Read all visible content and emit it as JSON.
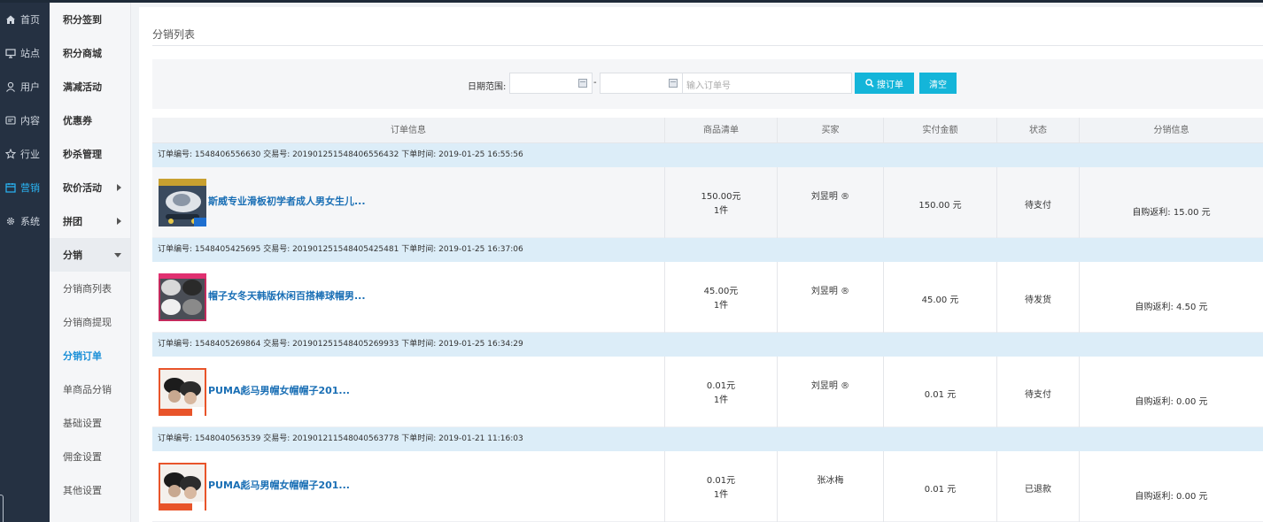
{
  "nav_main": [
    {
      "label": "首页",
      "icon": "home-icon"
    },
    {
      "label": "站点",
      "icon": "monitor-icon"
    },
    {
      "label": "用户",
      "icon": "user-icon"
    },
    {
      "label": "内容",
      "icon": "message-icon"
    },
    {
      "label": "行业",
      "icon": "star-icon"
    },
    {
      "label": "营销",
      "icon": "calendar-icon",
      "active": true
    },
    {
      "label": "系统",
      "icon": "gear-icon"
    }
  ],
  "nav_sub": [
    {
      "label": "积分签到"
    },
    {
      "label": "积分商城"
    },
    {
      "label": "满减活动"
    },
    {
      "label": "优惠券"
    },
    {
      "label": "秒杀管理"
    },
    {
      "label": "砍价活动"
    },
    {
      "label": "拼团"
    },
    {
      "label": "分销"
    },
    {
      "label": "分销商列表"
    },
    {
      "label": "分销商提现"
    },
    {
      "label": "分销订单"
    },
    {
      "label": "单商品分销"
    },
    {
      "label": "基础设置"
    },
    {
      "label": "佣金设置"
    },
    {
      "label": "其他设置"
    }
  ],
  "page": {
    "title": "分销列表"
  },
  "filter": {
    "date_label": "日期范围:",
    "date_start": "",
    "date_end": "",
    "dash": "-",
    "order_placeholder": "输入订单号",
    "search_label": "搜订单",
    "clear_label": "清空"
  },
  "table": {
    "headers": [
      "订单信息",
      "商品清单",
      "买家",
      "实付金额",
      "状态",
      "分销信息"
    ],
    "orders": [
      {
        "info": "订单编号: 1548406556630 交易号: 20190125154840655643​2 下单时间: 2019-01-25 16:55:56",
        "product": "斯威专业滑板初学者成人男女生儿...",
        "thumb_icon": "skateboard-thumbnail",
        "price": "150.00元",
        "qty": "1件",
        "buyer": "刘昱明 ®",
        "paid": "150.00 元",
        "status": "待支付",
        "dist": "自购返利: 15.00 元"
      },
      {
        "info": "订单编号: 1548405425695 交易号: 201901251548405425481 下单时间: 2019-01-25 16:37:06",
        "product": "帽子女冬天韩版休闲百搭棒球帽男...",
        "thumb_icon": "caps-thumbnail",
        "price": "45.00元",
        "qty": "1件",
        "buyer": "刘昱明 ®",
        "paid": "45.00 元",
        "status": "待发货",
        "dist": "自购返利: 4.50 元"
      },
      {
        "info": "订单编号: 1548405269864 交易号: 201901251548405269933 下单时间: 2019-01-25 16:34:29",
        "product": "PUMA彪马男帽女帽帽子201...",
        "thumb_icon": "puma-cap-thumbnail",
        "price": "0.01元",
        "qty": "1件",
        "buyer": "刘昱明 ®",
        "paid": "0.01 元",
        "status": "待支付",
        "dist": "自购返利: 0.00 元"
      },
      {
        "info": "订单编号: 1548040563539 交易号: 201901211548040563778 下单时间: 2019-01-21 11:16:03",
        "product": "PUMA彪马男帽女帽帽子201...",
        "thumb_icon": "puma-cap-thumbnail",
        "price": "0.01元",
        "qty": "1件",
        "buyer": "张冰梅",
        "paid": "0.01 元",
        "status": "已退款",
        "dist": "自购返利: 0.00 元"
      }
    ]
  },
  "colors": {
    "accent": "#14b5d9",
    "nav_bg": "#253142",
    "link": "#1a6fb5",
    "order_bar": "#dcedf8"
  }
}
